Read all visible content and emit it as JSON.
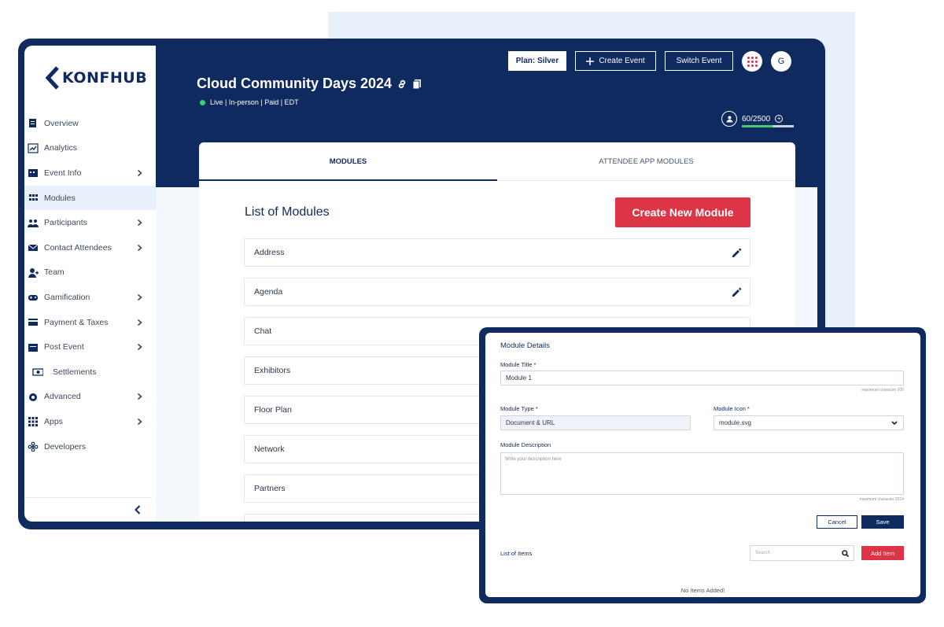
{
  "brand": {
    "name": "KONFHUB"
  },
  "sidebar": {
    "items": [
      {
        "label": "Overview",
        "icon": "overview-icon",
        "chevron": false
      },
      {
        "label": "Analytics",
        "icon": "analytics-icon",
        "chevron": false
      },
      {
        "label": "Event Info",
        "icon": "event-info-icon",
        "chevron": true
      },
      {
        "label": "Modules",
        "icon": "modules-icon",
        "chevron": false,
        "active": true
      },
      {
        "label": "Participants",
        "icon": "participants-icon",
        "chevron": true
      },
      {
        "label": "Contact Attendees",
        "icon": "contact-attendees-icon",
        "chevron": true
      },
      {
        "label": "Team",
        "icon": "team-icon",
        "chevron": false
      },
      {
        "label": "Gamification",
        "icon": "gamification-icon",
        "chevron": true
      },
      {
        "label": "Payment & Taxes",
        "icon": "payment-icon",
        "chevron": true
      },
      {
        "label": "Post Event",
        "icon": "post-event-icon",
        "chevron": true
      },
      {
        "label": "Settlements",
        "icon": "settlements-icon",
        "chevron": false
      },
      {
        "label": "Advanced",
        "icon": "advanced-icon",
        "chevron": true
      },
      {
        "label": "Apps",
        "icon": "apps-icon",
        "chevron": true
      },
      {
        "label": "Developers",
        "icon": "developers-icon",
        "chevron": false
      }
    ]
  },
  "header": {
    "event_title": "Cloud Community Days 2024",
    "event_status": "Live | In-person | Paid | EDT",
    "plan_label": "Plan: Silver",
    "create_event_label": "Create Event",
    "switch_event_label": "Switch Event",
    "avatar_initial": "G",
    "capacity_text": "60/2500",
    "capacity_fraction": 0.024
  },
  "tabs": [
    {
      "label": "MODULES",
      "active": true
    },
    {
      "label": "ATTENDEE APP MODULES",
      "active": false
    }
  ],
  "main": {
    "list_title": "List of Modules",
    "create_button": "Create New Module",
    "modules": [
      "Address",
      "Agenda",
      "Chat",
      "Exhibitors",
      "Floor Plan",
      "Network",
      "Partners"
    ]
  },
  "modal": {
    "title": "Module Details",
    "module_title_label": "Module Title *",
    "module_title_value": "Module 1",
    "title_hint": "maximum character 200",
    "module_type_label": "Module Type *",
    "module_type_value": "Document & URL",
    "module_icon_label": "Module Icon *",
    "module_icon_value": "module.svg",
    "description_label": "Module Description",
    "description_placeholder": "Write your description here",
    "description_hint": "maximum character 2024",
    "cancel_label": "Cancel",
    "save_label": "Save",
    "items_label": "List of Items",
    "search_placeholder": "Search",
    "add_item_label": "Add Item",
    "empty_text": "No Items Added!"
  },
  "colors": {
    "navy": "#0e2a5e",
    "accent_red": "#dc3545",
    "live_green": "#3ccf6b",
    "light_bg": "#e8f0fb"
  }
}
